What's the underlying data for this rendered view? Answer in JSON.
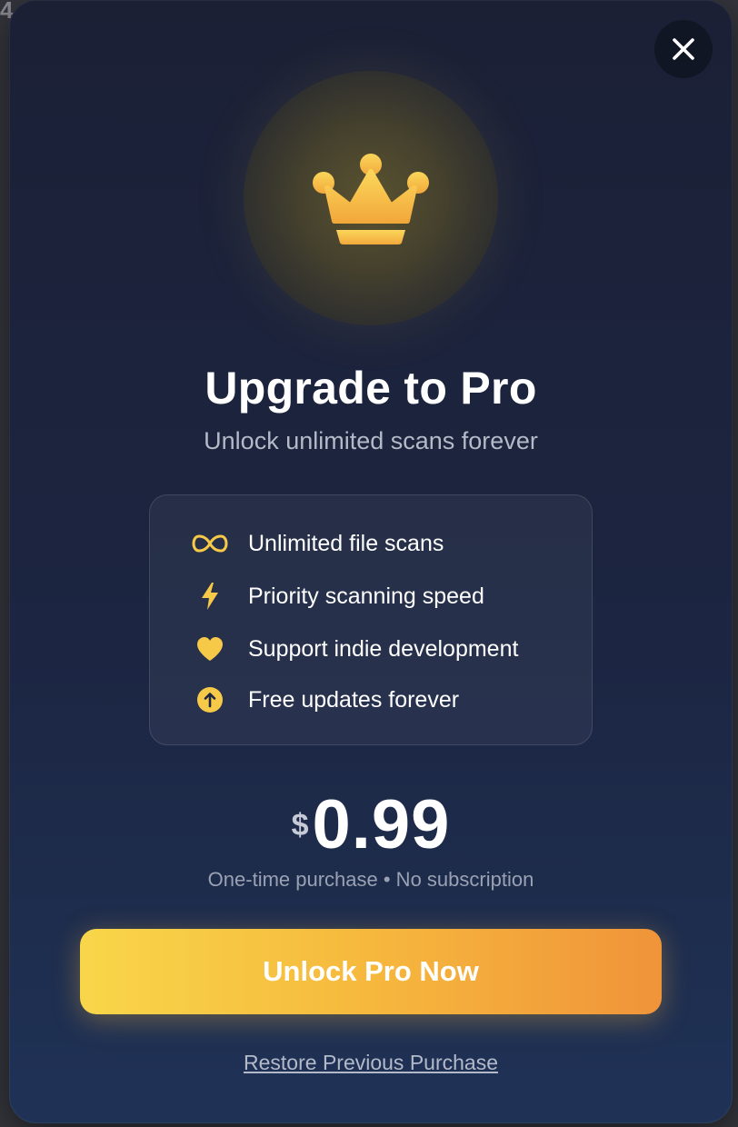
{
  "background": {
    "partial_text": "4"
  },
  "modal": {
    "close_label": "close",
    "title": "Upgrade to Pro",
    "subtitle": "Unlock unlimited scans forever",
    "features": [
      {
        "icon": "infinity-icon",
        "label": "Unlimited file scans"
      },
      {
        "icon": "lightning-icon",
        "label": "Priority scanning speed"
      },
      {
        "icon": "heart-icon",
        "label": "Support indie development"
      },
      {
        "icon": "arrow-up-circle-icon",
        "label": "Free updates forever"
      }
    ],
    "price": {
      "currency": "$",
      "amount": "0.99",
      "note": "One-time purchase • No subscription"
    },
    "cta_label": "Unlock Pro Now",
    "restore_label": "Restore Previous Purchase"
  },
  "colors": {
    "accent_yellow": "#f8d64a",
    "accent_orange": "#f0943a",
    "modal_bg": "#1c2541",
    "icon_yellow": "#f7c948"
  }
}
